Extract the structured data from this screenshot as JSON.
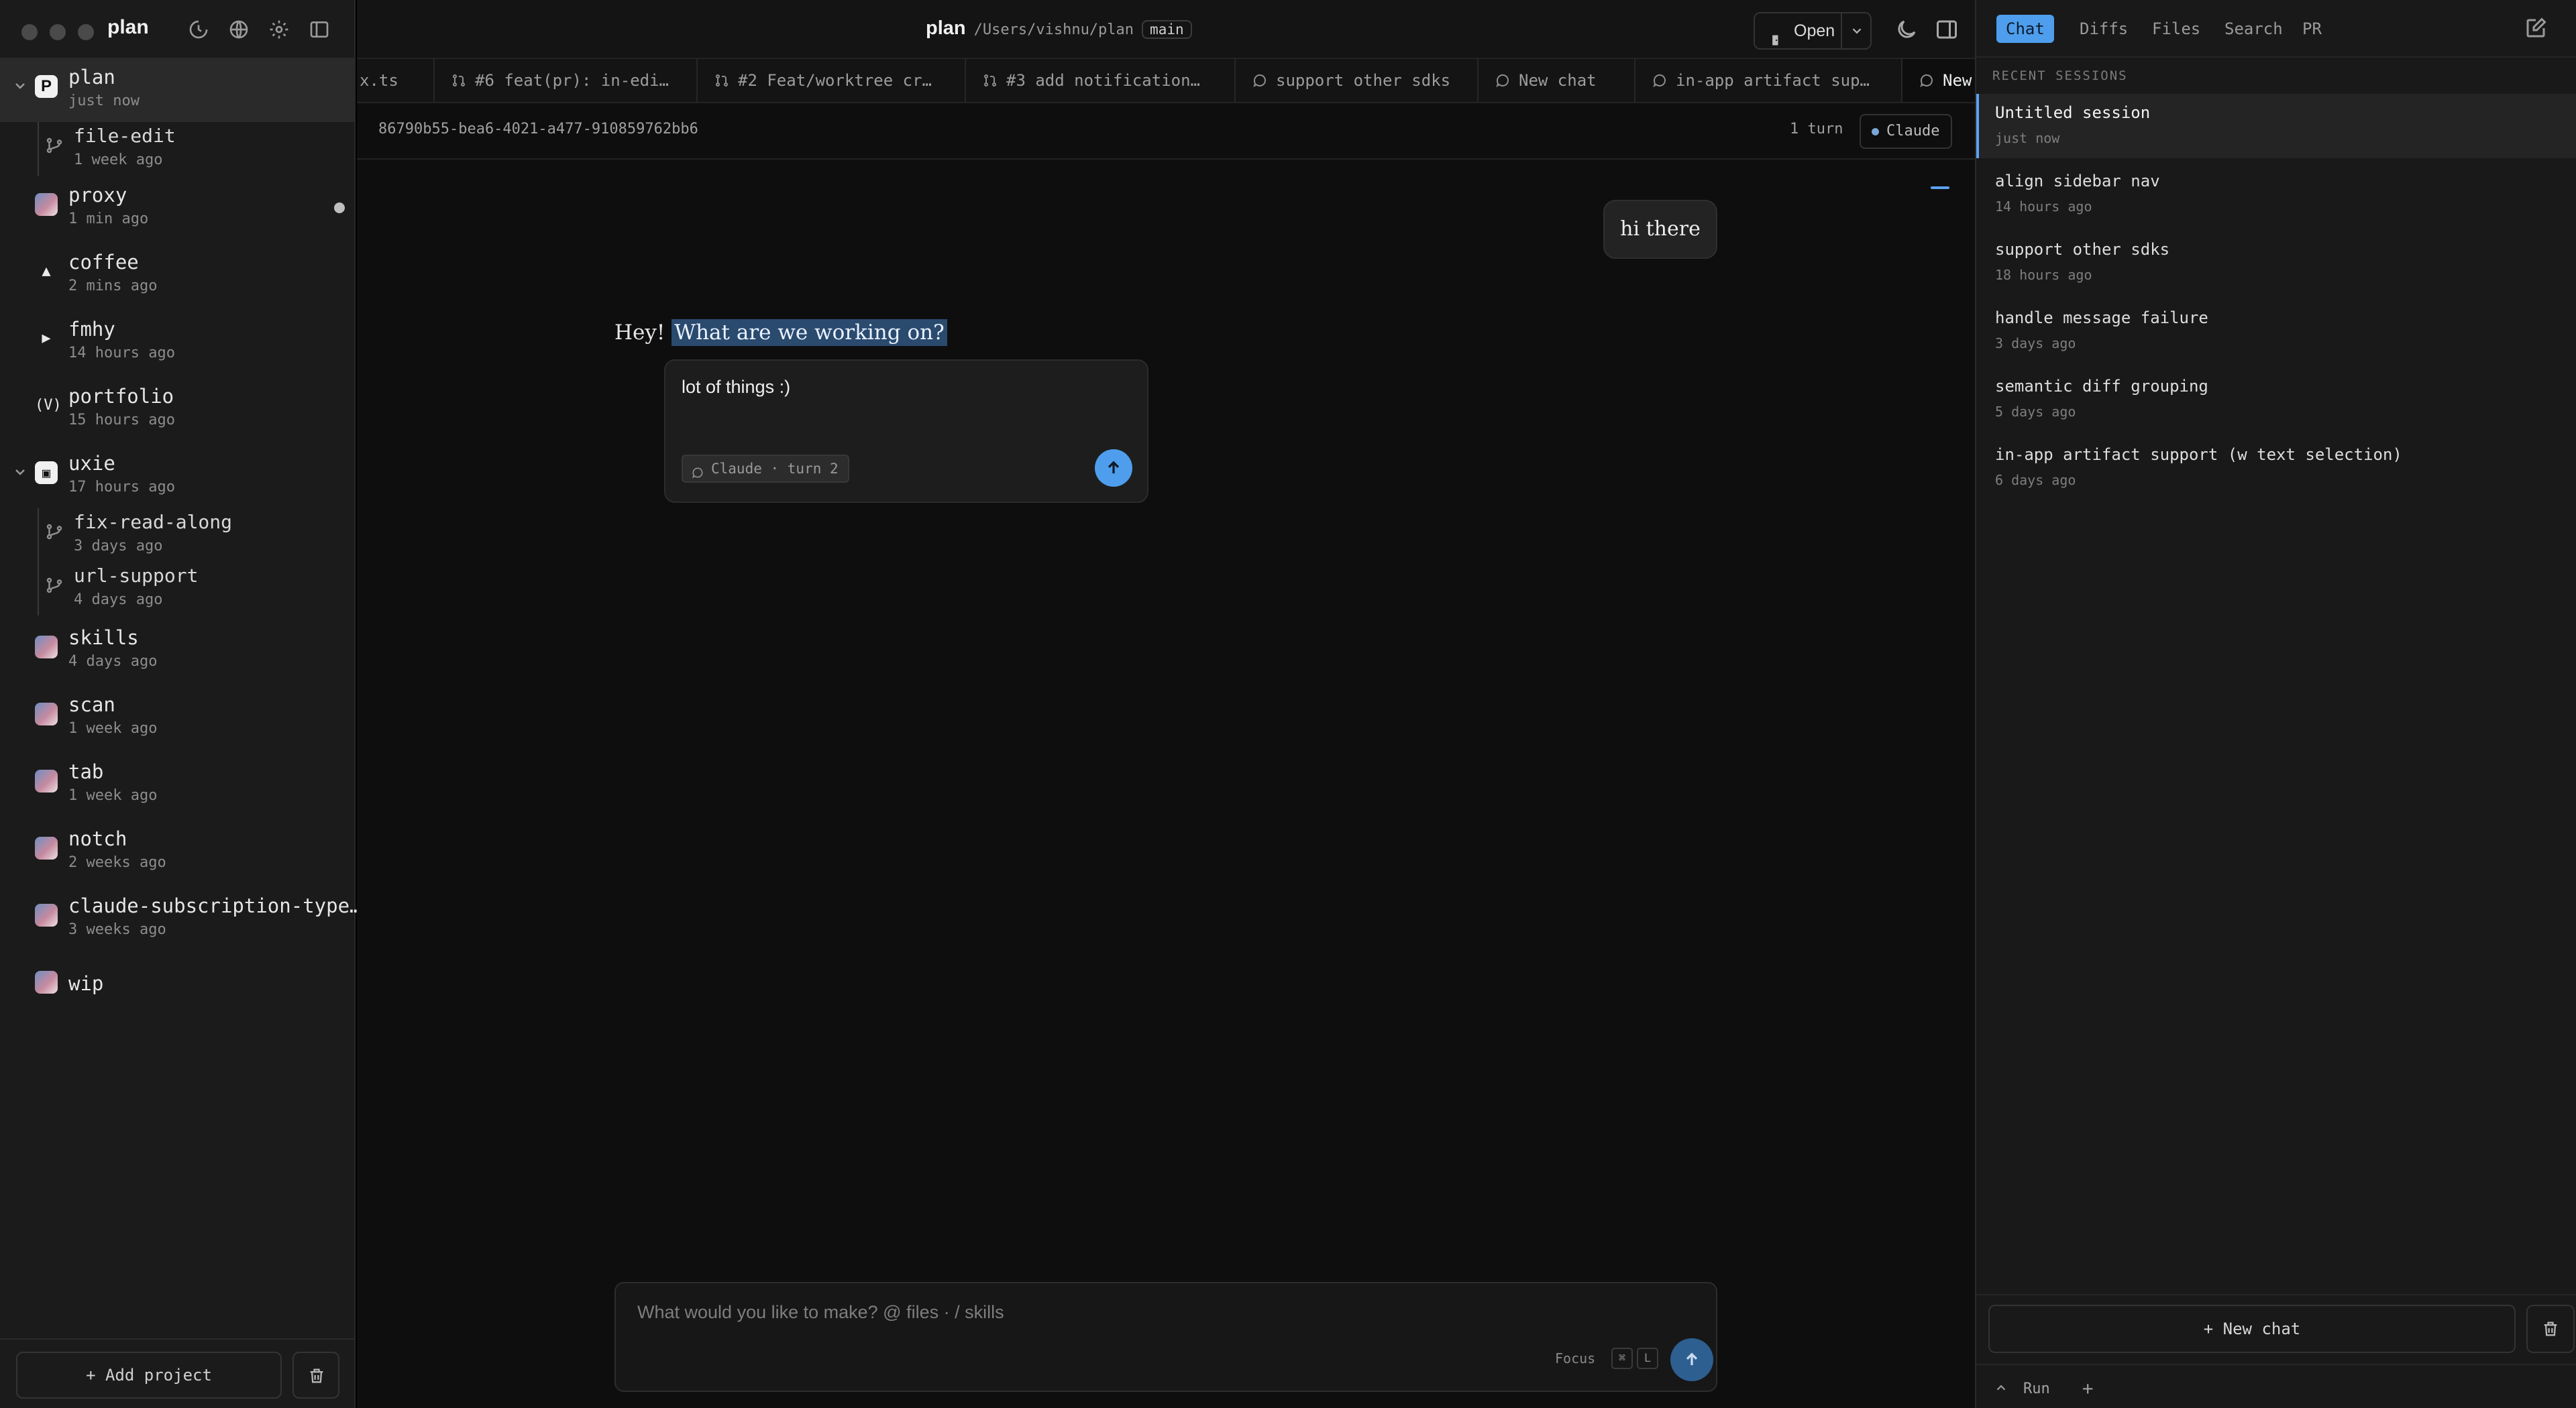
{
  "app": {
    "name": "plan"
  },
  "sidebar": {
    "projects": [
      {
        "name": "plan",
        "time": "just now",
        "icon": "p-letter-icon",
        "expanded": true,
        "active": true
      },
      {
        "branch": true,
        "name": "file-edit",
        "time": "1 week ago"
      },
      {
        "name": "proxy",
        "time": "1 min ago",
        "icon": "avatar-icon",
        "unread": true
      },
      {
        "name": "coffee",
        "time": "2 mins ago",
        "icon": "triangle-icon"
      },
      {
        "name": "fmhy",
        "time": "14 hours ago",
        "icon": "play-icon"
      },
      {
        "name": "portfolio",
        "time": "15 hours ago",
        "icon": "v-logo-icon"
      },
      {
        "name": "uxie",
        "time": "17 hours ago",
        "icon": "uxie-logo-icon",
        "expanded": true
      },
      {
        "branch": true,
        "name": "fix-read-along",
        "time": "3 days ago"
      },
      {
        "branch": true,
        "name": "url-support",
        "time": "4 days ago"
      },
      {
        "name": "skills",
        "time": "4 days ago",
        "icon": "avatar-icon"
      },
      {
        "name": "scan",
        "time": "1 week ago",
        "icon": "avatar-icon"
      },
      {
        "name": "tab",
        "time": "1 week ago",
        "icon": "avatar-icon"
      },
      {
        "name": "notch",
        "time": "2 weeks ago",
        "icon": "avatar-icon"
      },
      {
        "name": "claude-subscription-type…",
        "time": "3 weeks ago",
        "icon": "avatar-icon"
      },
      {
        "name": "wip",
        "time": "",
        "icon": "avatar-icon"
      }
    ],
    "add_project_label": "+ Add project"
  },
  "header": {
    "project": "plan",
    "path": "/Users/vishnu/plan",
    "branch": "main",
    "open_label": "Open"
  },
  "tabs": [
    {
      "label": "x.ts",
      "icon": ""
    },
    {
      "label": "#6 feat(pr): in-edi…",
      "icon": "pull-request-icon"
    },
    {
      "label": "#2 Feat/worktree cr…",
      "icon": "pull-request-icon"
    },
    {
      "label": "#3 add notification…",
      "icon": "pull-request-icon"
    },
    {
      "label": "support other sdks",
      "icon": "chat-bubble-icon"
    },
    {
      "label": "New chat",
      "icon": "chat-bubble-icon"
    },
    {
      "label": "in-app artifact sup…",
      "icon": "chat-bubble-icon"
    },
    {
      "label": "New",
      "icon": "chat-bubble-icon",
      "active": true
    }
  ],
  "session": {
    "id": "86790b55-bea6-4021-a477-910859762bb6",
    "turns": "1 turn",
    "model": "Claude"
  },
  "conversation": {
    "user_message": "hi there",
    "assistant_prefix": "Hey!",
    "assistant_highlight": "What are we working on?",
    "popover_text": "lot of things :)",
    "popover_tag": "Claude · turn 2"
  },
  "composer": {
    "placeholder": "What would you like to make? @ files · / skills",
    "value": "",
    "focus_label": "Focus",
    "key1": "⌘",
    "key2": "L"
  },
  "right_panel": {
    "tabs": [
      {
        "label": "Chat",
        "active": true
      },
      {
        "label": "Diffs"
      },
      {
        "label": "Files"
      },
      {
        "label": "Search"
      },
      {
        "label": "PR"
      }
    ],
    "recent_heading": "RECENT SESSIONS",
    "sessions": [
      {
        "title": "Untitled session",
        "time": "just now",
        "active": true
      },
      {
        "title": "align sidebar nav",
        "time": "14 hours ago"
      },
      {
        "title": "support other sdks",
        "time": "18 hours ago"
      },
      {
        "title": "handle message failure",
        "time": "3 days ago"
      },
      {
        "title": "semantic diff grouping",
        "time": "5 days ago"
      },
      {
        "title": "in-app artifact support (w text selection)",
        "time": "6 days ago"
      }
    ],
    "new_chat_label": "+ New chat",
    "run_label": "Run",
    "run_plus": "+"
  },
  "colors": {
    "accent": "#4e9eed",
    "background": "#0e0e0e",
    "sidebar": "#1b1b1b",
    "highlight": "#2a4a6e"
  }
}
